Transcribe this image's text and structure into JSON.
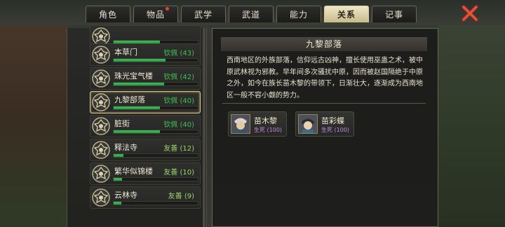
{
  "tabs": [
    {
      "label": "角色",
      "active": false,
      "notify": false
    },
    {
      "label": "物品",
      "active": false,
      "notify": true
    },
    {
      "label": "武学",
      "active": false,
      "notify": false
    },
    {
      "label": "武道",
      "active": false,
      "notify": false
    },
    {
      "label": "能力",
      "active": false,
      "notify": false
    },
    {
      "label": "关系",
      "active": true,
      "notify": false
    },
    {
      "label": "记事",
      "active": false,
      "notify": false
    }
  ],
  "factions": [
    {
      "name": "",
      "status": "",
      "progress": 0.55,
      "status_color": "#3fbf59"
    },
    {
      "name": "本草门",
      "status": "钦佩 (43)",
      "progress": 0.62,
      "status_color": "#3fbf59"
    },
    {
      "name": "珠光宝气楼",
      "status": "钦佩 (42)",
      "progress": 0.6,
      "status_color": "#3fbf59"
    },
    {
      "name": "九黎部落",
      "status": "钦佩 (40)",
      "progress": 0.55,
      "status_color": "#3fbf59",
      "selected": true
    },
    {
      "name": "脏街",
      "status": "钦佩 (40)",
      "progress": 0.55,
      "status_color": "#3fbf59"
    },
    {
      "name": "释法寺",
      "status": "友善 (12)",
      "progress": 0.12,
      "status_color": "#9bd36b"
    },
    {
      "name": "繁华似锦楼",
      "status": "友善 (10)",
      "progress": 0.1,
      "status_color": "#9bd36b"
    },
    {
      "name": "云林寺",
      "status": "友善 (9)",
      "progress": 0.09,
      "status_color": "#9bd36b"
    }
  ],
  "detail": {
    "title": "九黎部落",
    "description": "西南地区的外族部落，信仰远古凶神，擅长使用巫蛊之术，被中原武林视为邪教。早年间多次骚扰中原，因而被赵国隔绝于中原之外，如今在族长苗木黎的带领下，日渐壮大，逐渐成为西南地区一般不容小觑的势力。",
    "members": [
      {
        "name": "苗木黎",
        "relation": "生死 (100)"
      },
      {
        "name": "苗彩蝶",
        "relation": "生死 (100)"
      }
    ]
  },
  "icons": {
    "close": "close-x-icon",
    "emblem": "faction-emblem-icon"
  }
}
